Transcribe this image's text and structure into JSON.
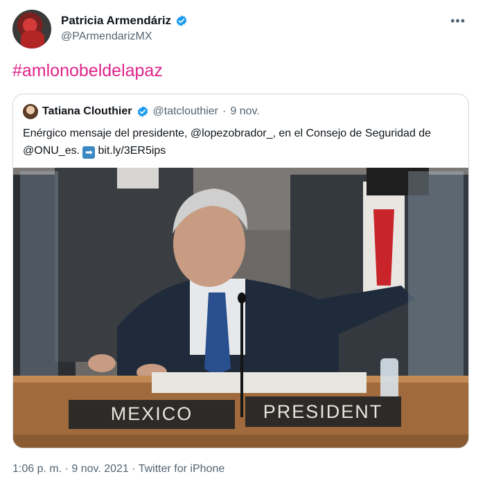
{
  "tweet": {
    "author_name": "Patricia Armendáriz",
    "author_handle": "@PArmendarizMX",
    "more_label": "•••",
    "hashtag": "#amlonobeldelapaz",
    "timestamp": "1:06 p. m. · 9 nov. 2021 · Twitter for iPhone"
  },
  "quoted": {
    "author_name": "Tatiana Clouthier",
    "author_handle": "@tatclouthier",
    "separator": "·",
    "date": "9 nov.",
    "text_before": "Enérgico mensaje del presidente, ",
    "mention1": "@lopezobrador_",
    "text_middle": ", en el Consejo de Seguridad de ",
    "mention2": "@ONU_es",
    "text_after": ". ",
    "arrow": "➡",
    "link": "bit.ly/3ER5ips"
  },
  "photo": {
    "placard_left": "MEXICO",
    "placard_right": "PRESIDENT"
  },
  "colors": {
    "hashtag": "#e0238a",
    "verified": "#1d9bf0",
    "secondary_text": "#536471",
    "border": "#cfd9de"
  }
}
